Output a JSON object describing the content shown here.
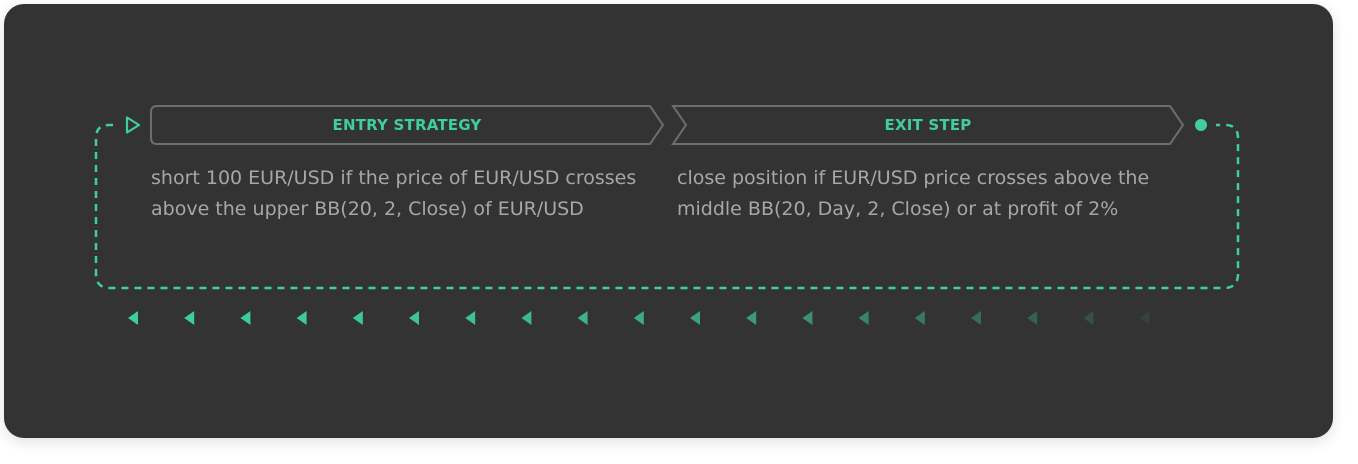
{
  "colors": {
    "background": "#333333",
    "accent": "#3ecf9c",
    "outline": "#6b6d70",
    "text": "#a7a7a7"
  },
  "steps": [
    {
      "title": "ENTRY STRATEGY",
      "description": "short 100 EUR/USD if the price of EUR/USD crosses above the upper BB(20, 2, Close) of EUR/USD"
    },
    {
      "title": "EXIT STEP",
      "description": "close position if EUR/USD price crosses above the middle BB(20, Day, 2, Close) or at profit of 2%"
    }
  ],
  "icons": {
    "start": "play-triangle-icon",
    "end": "circle-node-icon",
    "loop_arrows": "chevron-left-icon"
  }
}
